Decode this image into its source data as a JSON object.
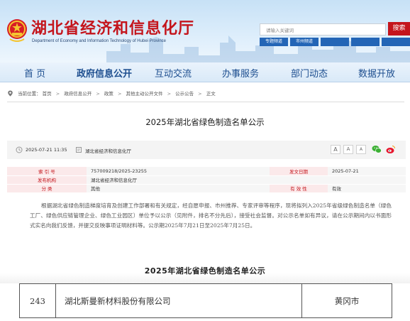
{
  "header": {
    "title": "湖北省经济和信息化厅",
    "subtitle": "Department of Economy and Information Technology of Hubei Province",
    "search_placeholder": "请输入关键词",
    "search_button": "搜索",
    "quick_links": [
      "专题频道",
      "市州频道",
      "",
      "",
      ""
    ]
  },
  "nav": {
    "items": [
      "首 页",
      "政府信息公开",
      "互动交流",
      "办事服务",
      "部门动态",
      "数据开放"
    ],
    "active_index": 1
  },
  "breadcrumb": {
    "label": "当前位置：",
    "items": [
      "首页",
      "政府信息公开",
      "政策",
      "其他主动公开文件",
      "公示公告",
      "正文"
    ]
  },
  "article": {
    "title": "2025年湖北省绿色制造名单公示",
    "date": "2025-07-21 11:35",
    "source": "湖北省经济和信息化厅",
    "font_sizes": [
      "A",
      "A",
      "A"
    ],
    "info": {
      "index_label": "索 引 号",
      "index_value": "757009218/2025-23255",
      "date_label": "发文日期",
      "date_value": "2025-07-21",
      "org_label": "发布机构",
      "org_value": "湖北省经济和信息化厅",
      "class_label": "分 类",
      "class_value": "其他",
      "validity_label": "有 效 性",
      "validity_value": "有效"
    },
    "paragraph": "根据湖北省绿色制造梯度培育及创建工作部署和有关规定，经自愿申报、市州推荐、专家评审等程序，现将拟列入2025年省级绿色制造名单（绿色工厂、绿色供应链管理企业、绿色工业园区）单位予以公示（见附件，排名不分先后），接受社会监督。对公示名单如有异议，请在公示期间内以书面形式实名向我们反馈，并提交反映事项证明材料等。公示期2025年7月21日至2025年7月25日。",
    "list_title": "2025年湖北省绿色制造名单公示",
    "list_row": {
      "no": "243",
      "company": "湖北斯曼新材料股份有限公司",
      "city": "黄冈市"
    }
  }
}
